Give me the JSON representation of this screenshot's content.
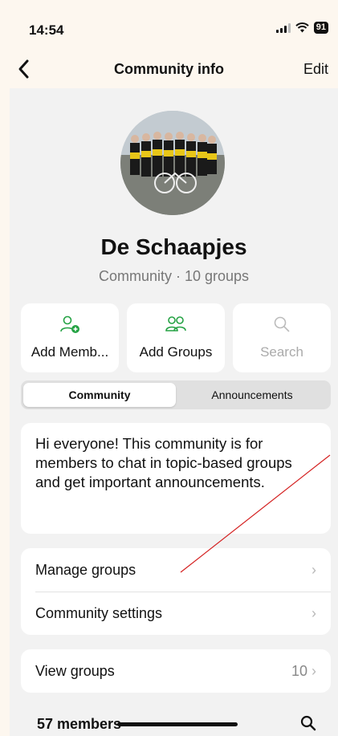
{
  "status": {
    "time": "14:54",
    "battery": "91"
  },
  "header": {
    "title": "Community info",
    "edit_label": "Edit"
  },
  "community": {
    "name": "De Schaapjes",
    "subtitle": "Community · 10 groups"
  },
  "actions": [
    {
      "label": "Add Memb...",
      "icon": "add-member-icon",
      "color": "#25a244"
    },
    {
      "label": "Add Groups",
      "icon": "add-groups-icon",
      "color": "#25a244"
    },
    {
      "label": "Search",
      "icon": "search-icon",
      "disabled": true
    }
  ],
  "tabs": [
    {
      "label": "Community",
      "active": true
    },
    {
      "label": "Announcements",
      "active": false
    }
  ],
  "description": "Hi everyone! This community is for members to chat in topic-based groups and get important announcements.",
  "settings": [
    {
      "label": "Manage groups"
    },
    {
      "label": "Community settings"
    }
  ],
  "view_groups": {
    "label": "View groups",
    "count": "10"
  },
  "members": {
    "label": "57 members"
  },
  "colors": {
    "accent": "#25a244",
    "annotation": "#d42020"
  }
}
